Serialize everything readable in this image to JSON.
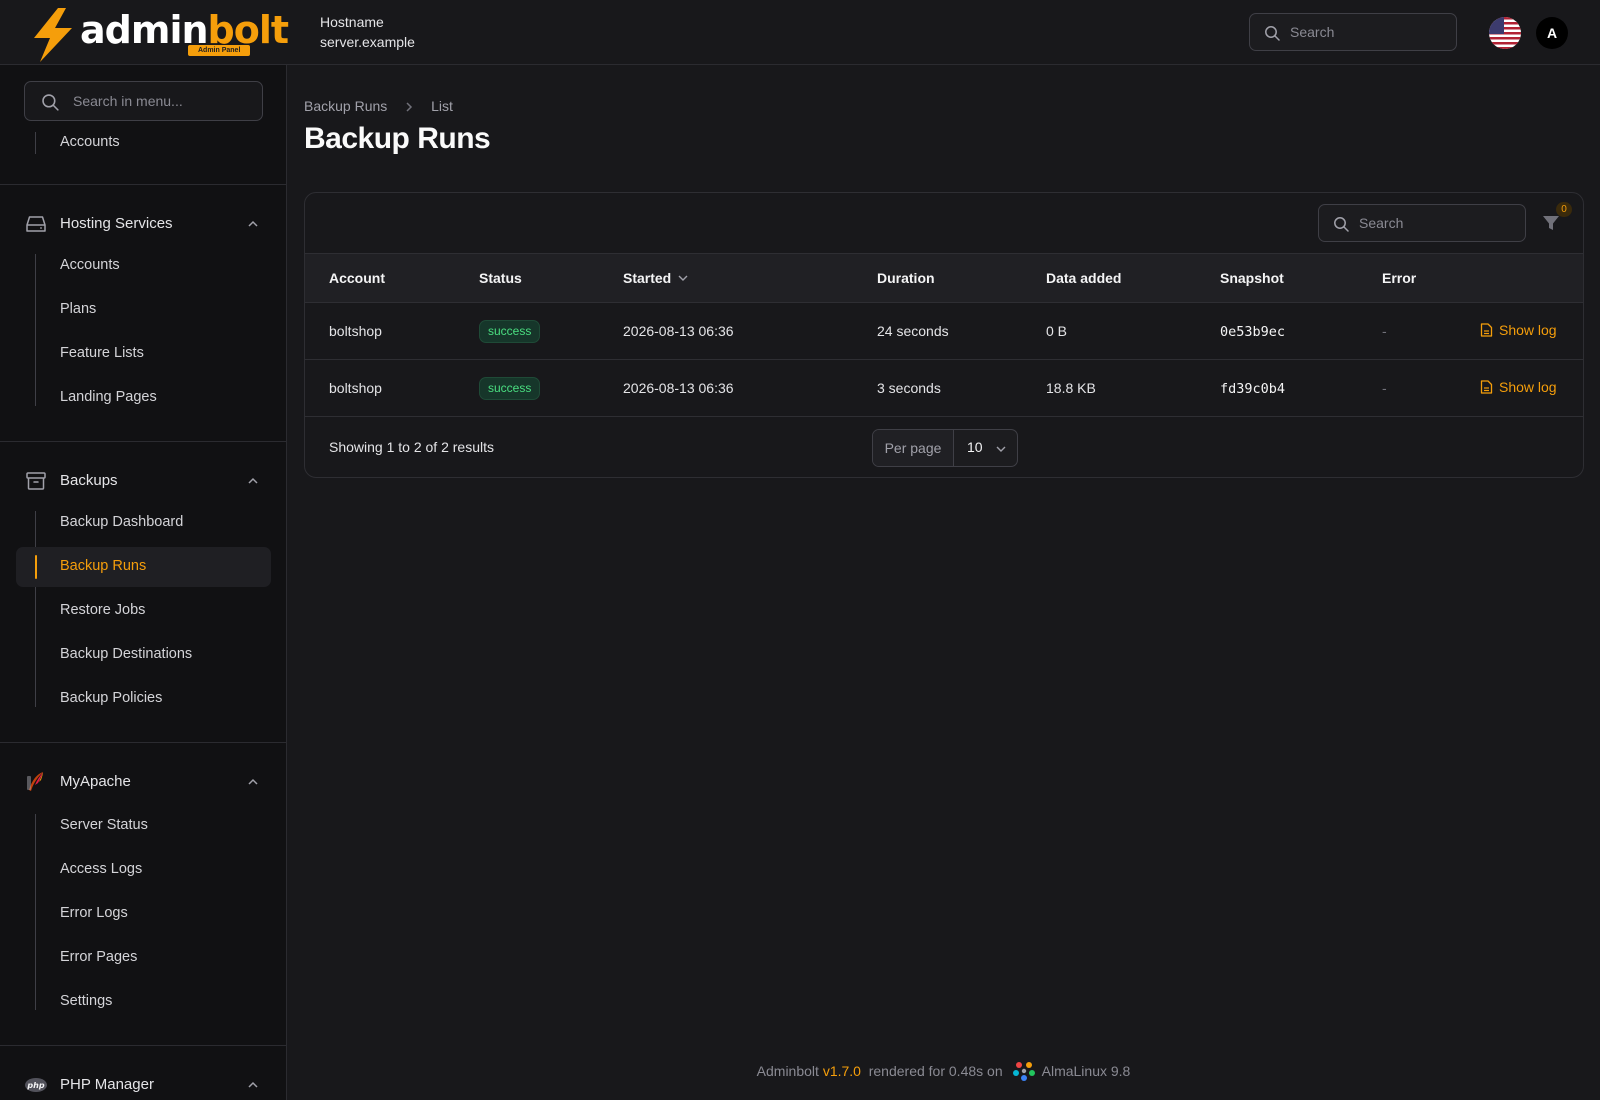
{
  "header": {
    "logo_text_a": "admin",
    "logo_text_b": "bolt",
    "logo_badge": "Admin Panel",
    "hostname_label": "Hostname",
    "hostname_value": "server.example",
    "search_placeholder": "Search",
    "avatar_initial": "A",
    "accent_color": "#f59e0b"
  },
  "sidebar": {
    "search_placeholder": "Search in menu...",
    "top_item": "Accounts",
    "groups": [
      {
        "label": "Hosting Services",
        "icon": "server-icon",
        "items": [
          "Accounts",
          "Plans",
          "Feature Lists",
          "Landing Pages"
        ]
      },
      {
        "label": "Backups",
        "icon": "archive-icon",
        "items": [
          "Backup Dashboard",
          "Backup Runs",
          "Restore Jobs",
          "Backup Destinations",
          "Backup Policies"
        ],
        "active": "Backup Runs"
      },
      {
        "label": "MyApache",
        "icon": "apache-feather-icon",
        "items": [
          "Server Status",
          "Access Logs",
          "Error Logs",
          "Error Pages",
          "Settings"
        ]
      },
      {
        "label": "PHP Manager",
        "icon": "php-icon",
        "items": []
      }
    ]
  },
  "main": {
    "breadcrumb": [
      "Backup Runs",
      "List"
    ],
    "title": "Backup Runs",
    "table": {
      "search_placeholder": "Search",
      "filter_count": "0",
      "columns": [
        "Account",
        "Status",
        "Started",
        "Duration",
        "Data added",
        "Snapshot",
        "Error"
      ],
      "sorted_column": "Started",
      "rows": [
        {
          "account": "boltshop",
          "status": "success",
          "started": "2026-08-13 06:36",
          "duration": "24 seconds",
          "data_added": "0 B",
          "snapshot": "0e53b9ec",
          "error": "-",
          "action": "Show log"
        },
        {
          "account": "boltshop",
          "status": "success",
          "started": "2026-08-13 06:36",
          "duration": "3 seconds",
          "data_added": "18.8 KB",
          "snapshot": "fd39c0b4",
          "error": "-",
          "action": "Show log"
        }
      ],
      "results_text": "Showing 1 to 2 of 2 results",
      "per_page_label": "Per page",
      "per_page_value": "10"
    }
  },
  "footer": {
    "prefix": "Adminbolt",
    "version": "v1.7.0",
    "rendered": "rendered for 0.48s on",
    "os": "AlmaLinux 9.8"
  }
}
